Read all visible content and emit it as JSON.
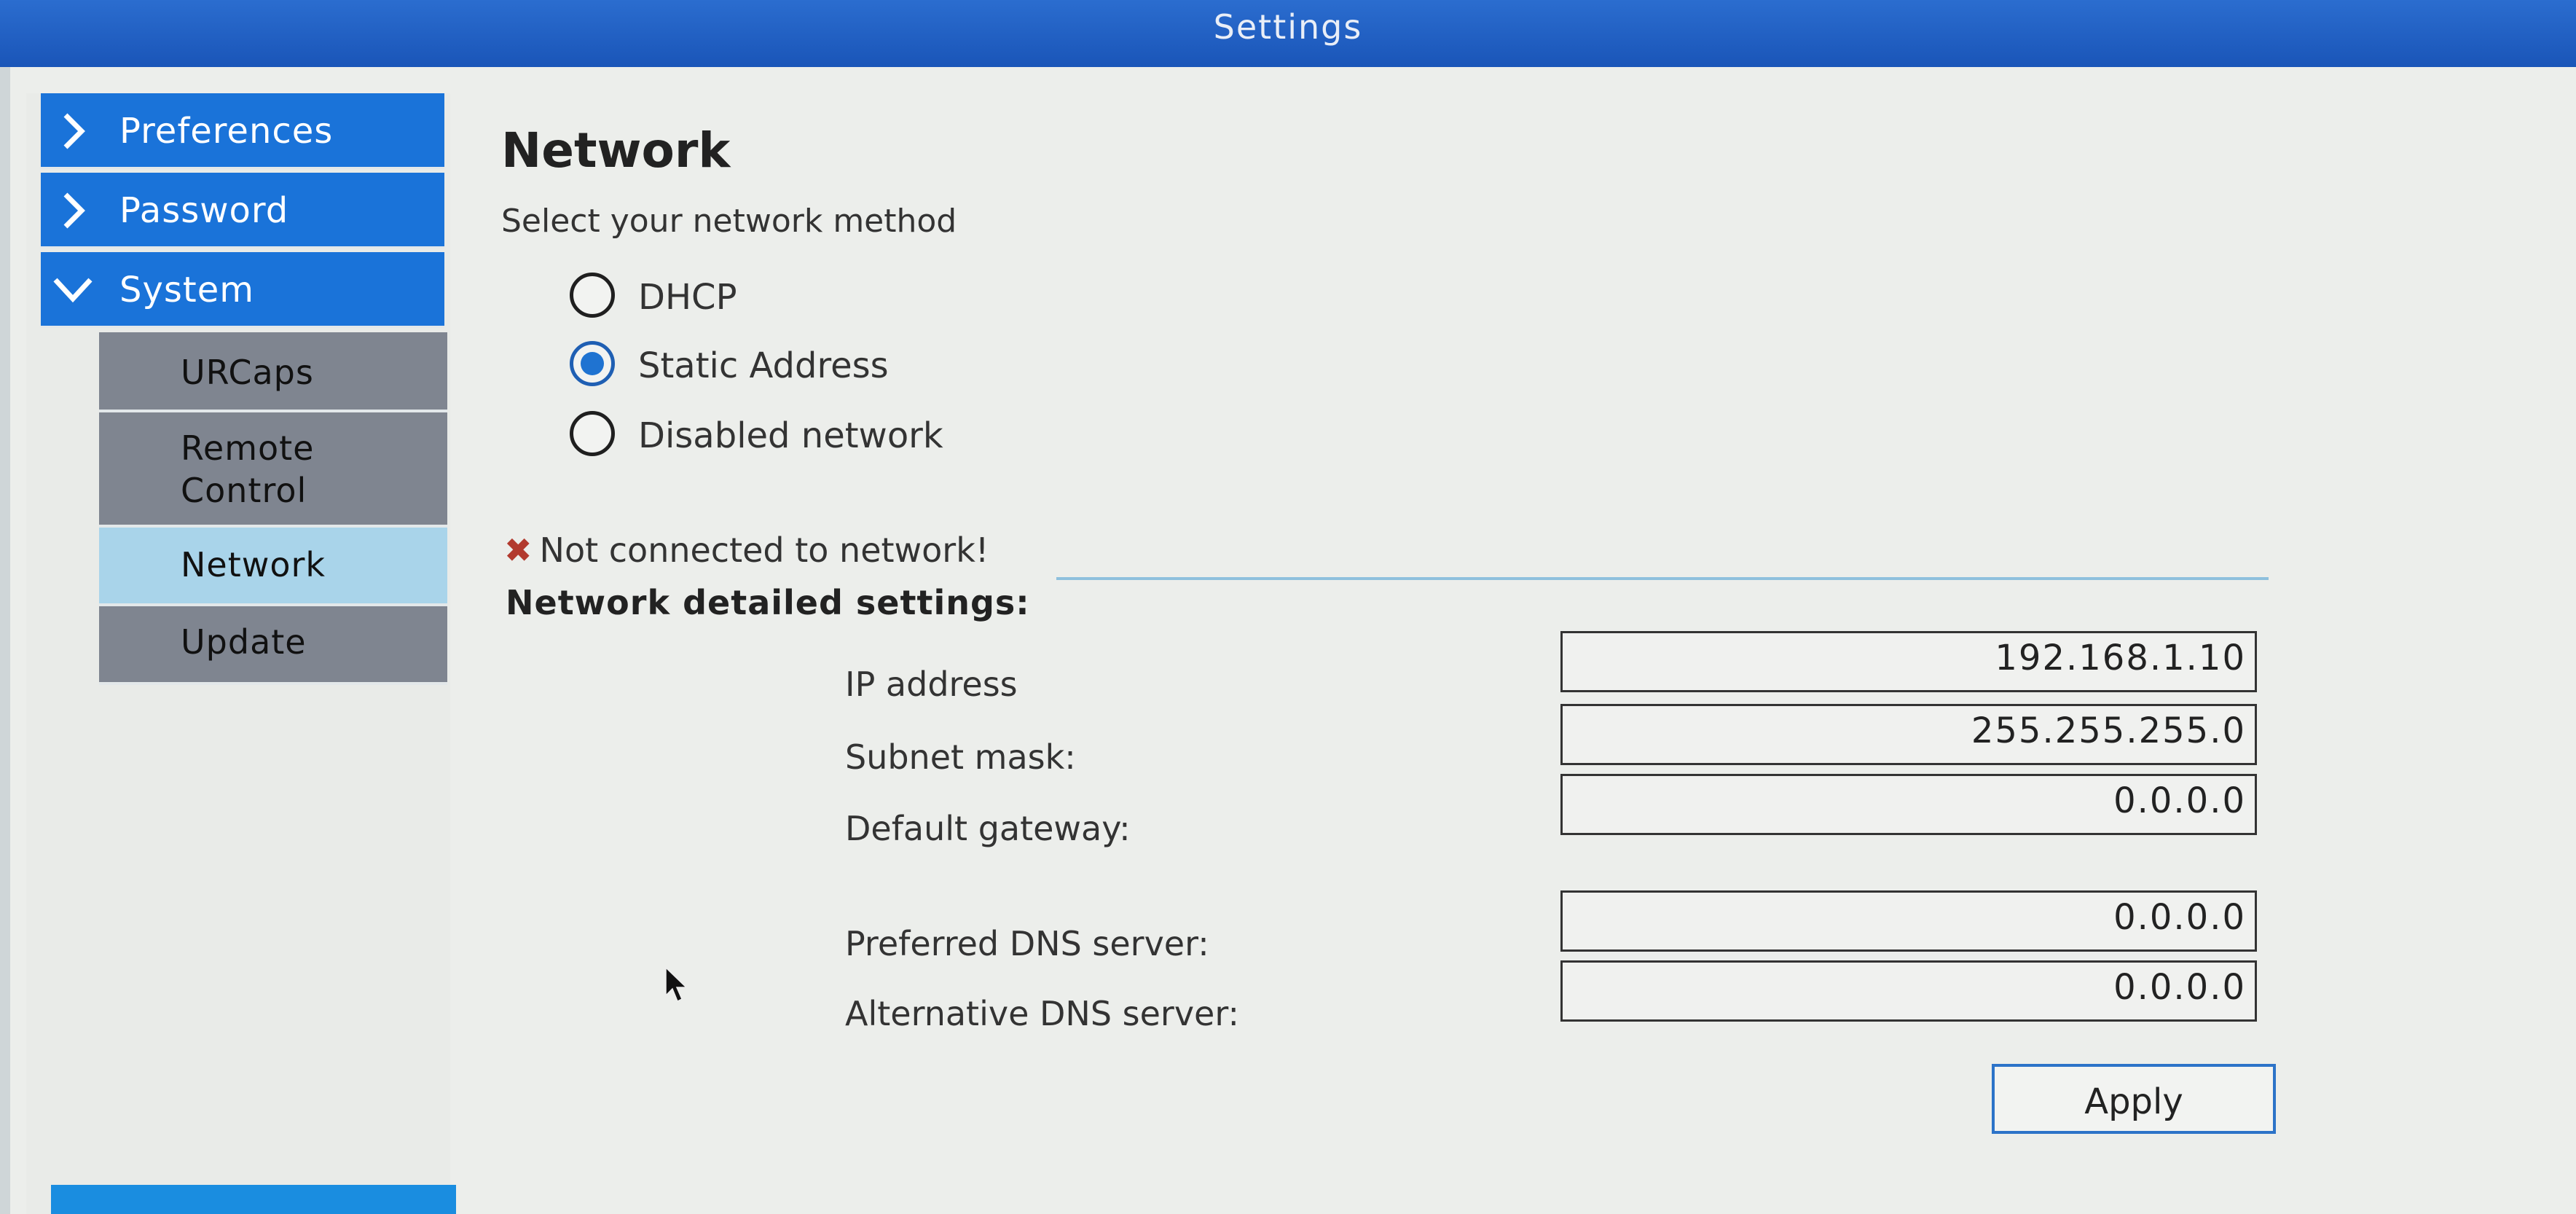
{
  "window": {
    "title": "Settings"
  },
  "sidebar": {
    "items": [
      {
        "label": "Preferences",
        "expanded": false
      },
      {
        "label": "Password",
        "expanded": false
      },
      {
        "label": "System",
        "expanded": true
      }
    ],
    "subitems": [
      {
        "label": "URCaps"
      },
      {
        "label": "Remote Control"
      },
      {
        "label": "Network",
        "active": true
      },
      {
        "label": "Update"
      }
    ]
  },
  "main": {
    "title": "Network",
    "method_prompt": "Select your network method",
    "methods": [
      {
        "label": "DHCP",
        "selected": false
      },
      {
        "label": "Static Address",
        "selected": true
      },
      {
        "label": "Disabled network",
        "selected": false
      }
    ],
    "status_text": "Not connected to network!",
    "details_heading": "Network detailed settings:",
    "fields": [
      {
        "label": "IP address",
        "value": "192.168.1.10"
      },
      {
        "label": "Subnet mask:",
        "value": "255.255.255.0"
      },
      {
        "label": "Default gateway:",
        "value": "0.0.0.0"
      },
      {
        "label": "Preferred DNS server:",
        "value": "0.0.0.0"
      },
      {
        "label": "Alternative DNS server:",
        "value": "0.0.0.0"
      }
    ],
    "apply_label": "Apply"
  },
  "colors": {
    "title_bar": "#1a55b8",
    "nav_active": "#1a73d9",
    "nav_sub": "#7f8590",
    "nav_sub_active": "#a9d4ea",
    "radio_selected": "#1f73d1",
    "error": "#b23a2e"
  }
}
